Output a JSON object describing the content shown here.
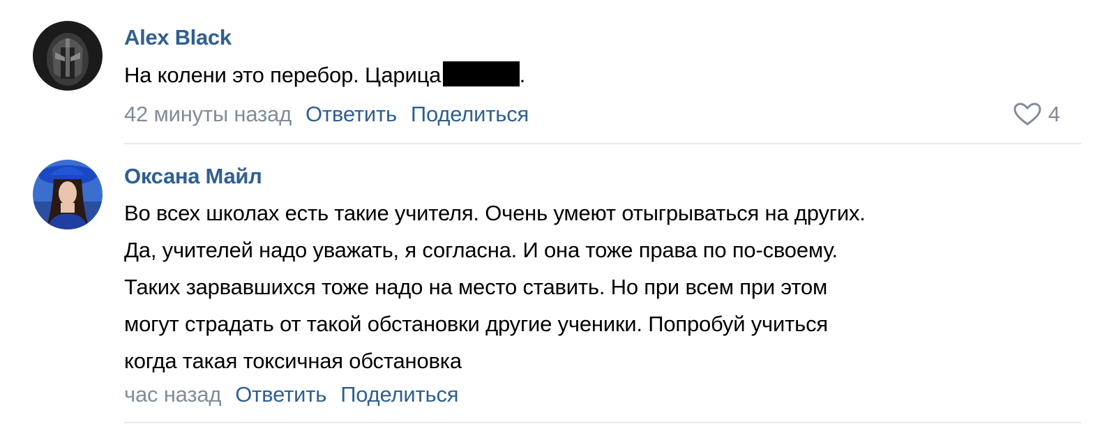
{
  "comments": [
    {
      "author": "Alex Black",
      "avatar_icon": "dark-helmet-avatar",
      "text_lines": [
        {
          "before": "На колени это перебор. Царица,",
          "redacted": true,
          "after": "."
        }
      ],
      "time": "42 минуты назад",
      "reply_label": "Ответить",
      "share_label": "Поделиться",
      "like_icon": "heart-outline-icon",
      "likes": "4"
    },
    {
      "author": "Оксана Майл",
      "avatar_icon": "woman-blue-hat-avatar",
      "text_lines": [
        "Во всех школах есть такие учителя. Очень умеют отыгрываться на других.",
        "Да, учителей надо уважать, я согласна. И она тоже права по по-своему.",
        "Таких зарвавшихся тоже надо на место ставить. Но при всем при этом",
        "могут страдать от такой обстановки другие ученики. Попробуй учиться",
        "когда такая токсичная обстановка"
      ],
      "time": "час назад",
      "reply_label": "Ответить",
      "share_label": "Поделиться"
    }
  ],
  "colors": {
    "author": "#2f5f92",
    "meta": "#818c99",
    "divider": "#e7e8ec"
  }
}
